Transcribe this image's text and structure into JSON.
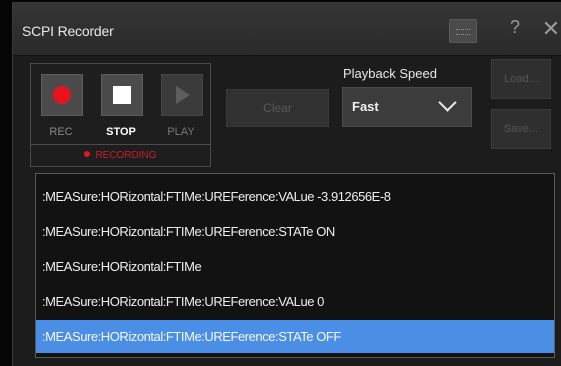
{
  "window": {
    "title": "SCPI Recorder",
    "help_glyph": "?",
    "close_glyph": "✕"
  },
  "recorder": {
    "rec_label": "REC",
    "stop_label": "STOP",
    "play_label": "PLAY",
    "status": "RECORDING"
  },
  "toolbar": {
    "clear_label": "Clear",
    "speed_label": "Playback Speed",
    "speed_value": "Fast",
    "load_label": "Load...",
    "save_label": "Save..."
  },
  "commands": [
    ":MEASure:HORizontal:FTIMe:UREFerence:VALue -3.912656E-8",
    ":MEASure:HORizontal:FTIMe:UREFerence:STATe ON",
    ":MEASure:HORizontal:FTIMe",
    ":MEASure:HORizontal:FTIMe:UREFerence:VALue 0",
    ":MEASure:HORizontal:FTIMe:UREFerence:STATe OFF"
  ],
  "selected_index": 4,
  "colors": {
    "accent": "#4a8ee6",
    "record": "#e8141b"
  },
  "icons": [
    "keyboard-icon",
    "record-icon",
    "stop-icon",
    "play-icon",
    "chevron-down-icon"
  ]
}
